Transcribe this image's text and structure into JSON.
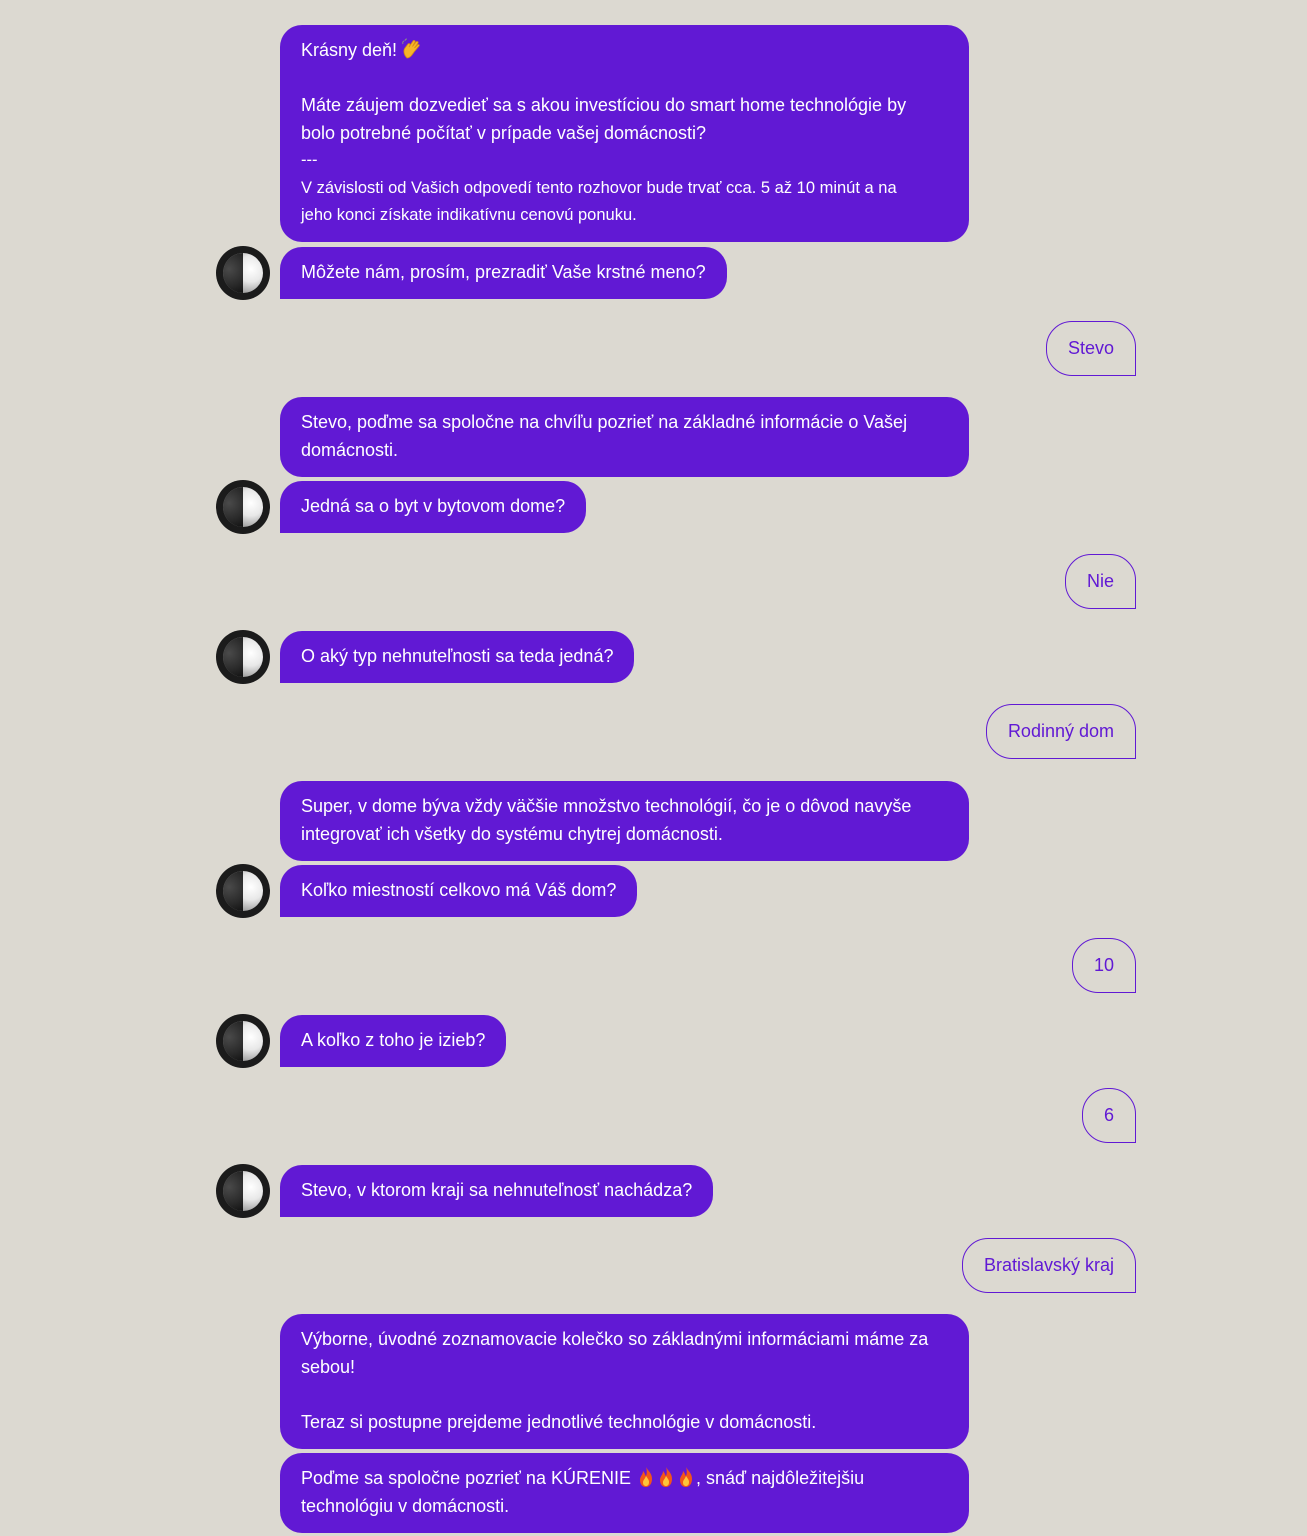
{
  "colors": {
    "background": "#dcd9d1",
    "accent": "#6119d4",
    "bot_text": "#ffffff",
    "avatar": "#1b1b1b"
  },
  "messages": {
    "m1": {
      "greeting": "Krásny deň!",
      "greeting_emoji": "waving-hand",
      "line1": "Máte záujem dozvedieť sa s akou investíciou do smart home technológie by",
      "line2": "bolo potrebné počítať v prípade vašej domácnosti?",
      "separator": "---",
      "line3": "V závislosti od Vašich odpovedí tento rozhovor bude trvať cca. 5 až 10 minút a na",
      "line4": "jeho konci získate indikatívnu cenovú ponuku."
    },
    "m2": "Môžete nám, prosím, prezradiť Vaše krstné meno?",
    "u1": "Stevo",
    "m3": {
      "line1": "Stevo, poďme sa spoločne na chvíľu pozrieť na základné informácie o Vašej",
      "line2": "domácnosti."
    },
    "m4": "Jedná sa o byt v bytovom dome?",
    "u2": "Nie",
    "m5": "O aký typ nehnuteľnosti sa teda jedná?",
    "u3": "Rodinný dom",
    "m6": {
      "line1": "Super, v dome býva vždy väčšie množstvo technológií, čo je o dôvod navyše",
      "line2": "integrovať ich všetky do systému chytrej domácnosti."
    },
    "m7": "Koľko miestností celkovo má Váš dom?",
    "u4": "10",
    "m8": "A koľko z toho je izieb?",
    "u5": "6",
    "m9": "Stevo, v ktorom kraji sa nehnuteľnosť nachádza?",
    "u6": "Bratislavský kraj",
    "m10": {
      "line1": "Výborne, úvodné zoznamovacie kolečko so základnými informáciami máme za",
      "line2": "sebou!",
      "line3": "Teraz si postupne prejdeme jednotlivé technológie v domácnosti."
    },
    "m11": {
      "part1": "Poďme sa spoločne pozrieť na KÚRENIE",
      "emoji": "fire",
      "part2": ", snáď najdôležitejšiu",
      "line2": "technológiu v domácnosti."
    }
  }
}
